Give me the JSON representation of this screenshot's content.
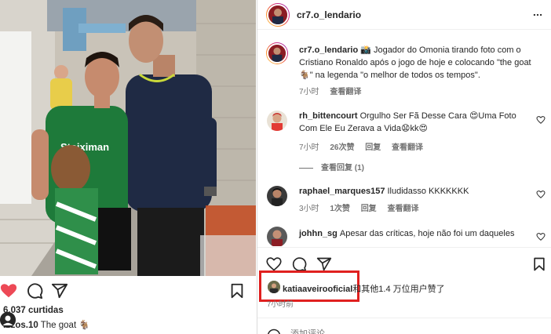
{
  "left": {
    "likes_count": "6.037 curtidas",
    "caption_user": "lezos.10",
    "caption_text": "The goat 🐐"
  },
  "post": {
    "username": "cr7.o_lendario"
  },
  "caption": {
    "user": "cr7.o_lendario",
    "text": "📸 Jogador do Omonia tirando foto com o Cristiano Ronaldo após o jogo de hoje e colocando \"the goat 🐐\" na legenda \"o melhor de todos os tempos\".",
    "time": "7小时",
    "translate": "查看翻译"
  },
  "comments": [
    {
      "user": "rh_bittencourt",
      "text": "Orgulho Ser Fã Desse Cara 😍Uma Foto Com Ele Eu Zerava a Vida😧kk😍",
      "time": "7小时",
      "likes": "26次赞",
      "reply": "回复",
      "translate": "查看翻译"
    },
    {
      "user": "raphael_marques157",
      "text": "Iludidasso KKKKKKK",
      "time": "3小时",
      "likes": "1次赞",
      "reply": "回复",
      "translate": "查看翻译"
    },
    {
      "user": "johhn_sg",
      "text": "Apesar das críticas, hoje não foi um daqueles"
    }
  ],
  "view_replies": "查看回复 (1)",
  "liked_by": {
    "user": "katiaaveirooficial",
    "suffix": "和其他1.4 万位用户赞了"
  },
  "post_time": "7小时前",
  "add_comment_placeholder": "添加评论……",
  "colors": {
    "like_red": "#ed4956",
    "highlight_box": "#e0201f",
    "text": "#262626",
    "muted": "#737373"
  }
}
